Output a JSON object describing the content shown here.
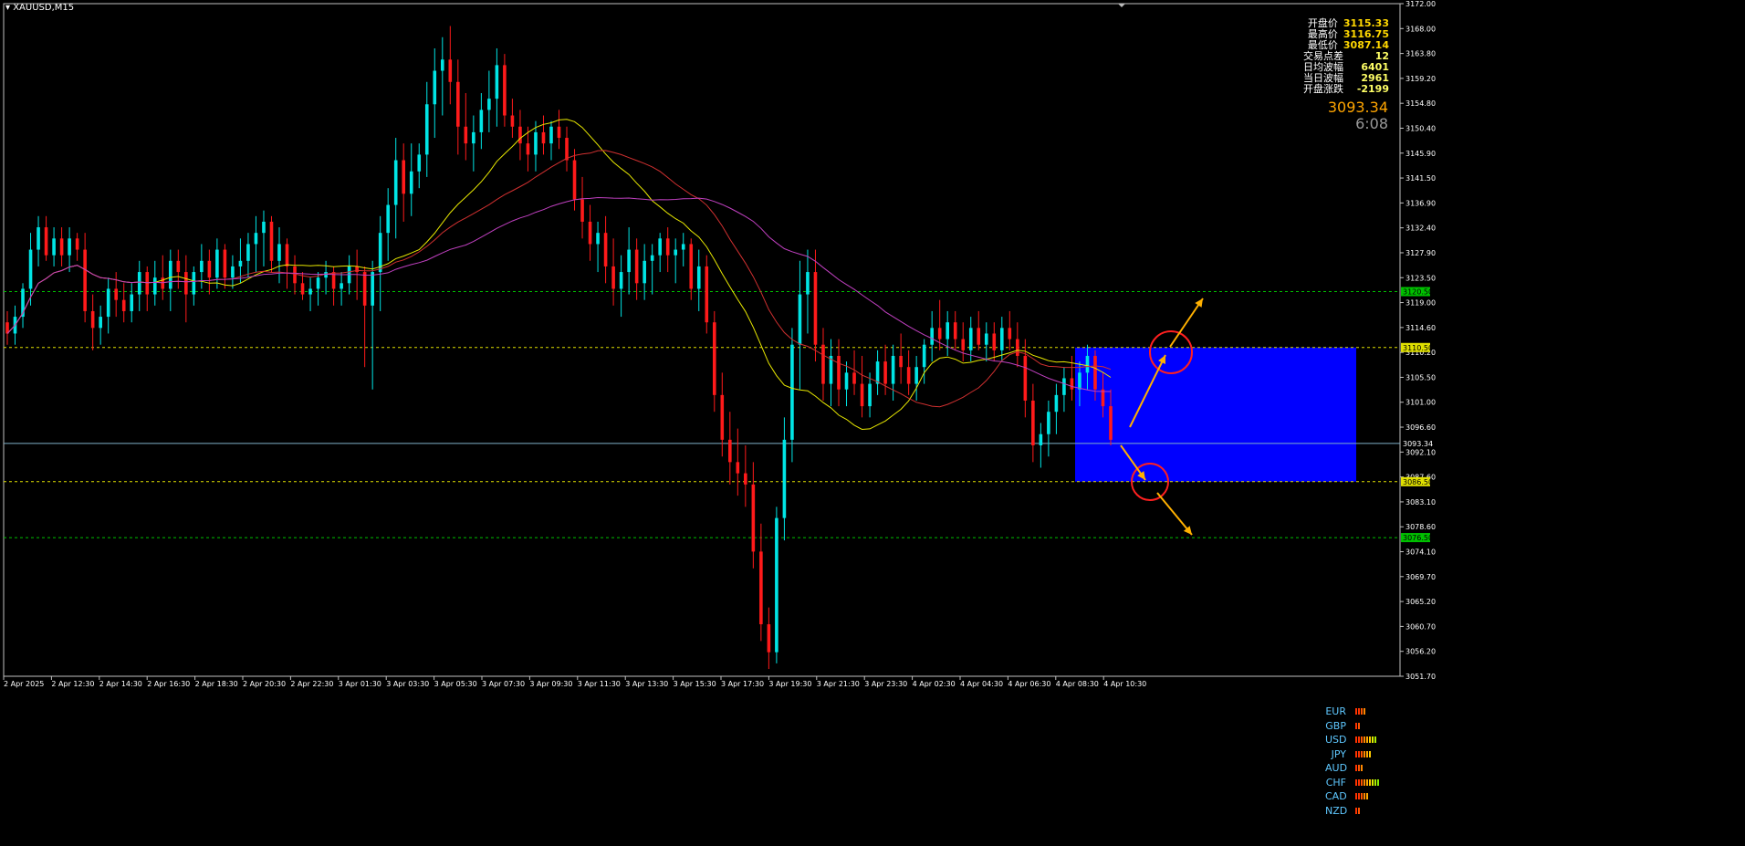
{
  "symbol": "XAUUSD,M15",
  "info": {
    "rows": [
      {
        "label": "开盘价",
        "value": "3115.33"
      },
      {
        "label": "最高价",
        "value": "3116.75"
      },
      {
        "label": "最低价",
        "value": "3087.14"
      },
      {
        "label": "交易点差",
        "value": "12"
      },
      {
        "label": "日均波幅",
        "value": "6401"
      },
      {
        "label": "当日波幅",
        "value": "2961"
      },
      {
        "label": "开盘涨跌",
        "value": "-2199"
      }
    ],
    "current_price": "3093.34",
    "countdown": "6:08"
  },
  "chart_data": {
    "type": "candlestick",
    "ylim": [
      3051.7,
      3172.0
    ],
    "y_ticks": [
      "3172.00",
      "3168.00",
      "3163.80",
      "3159.20",
      "3154.80",
      "3150.40",
      "3145.90",
      "3141.50",
      "3136.90",
      "3132.40",
      "3127.90",
      "3123.50",
      "3119.00",
      "3114.60",
      "3110.20",
      "3105.50",
      "3101.00",
      "3096.60",
      "3092.10",
      "3087.60",
      "3083.10",
      "3078.60",
      "3074.10",
      "3069.70",
      "3065.20",
      "3060.70",
      "3056.20",
      "3051.70"
    ],
    "x_ticks": [
      "2 Apr 2025",
      "2 Apr 12:30",
      "2 Apr 14:30",
      "2 Apr 16:30",
      "2 Apr 18:30",
      "2 Apr 20:30",
      "2 Apr 22:30",
      "3 Apr 01:30",
      "3 Apr 03:30",
      "3 Apr 05:30",
      "3 Apr 07:30",
      "3 Apr 09:30",
      "3 Apr 11:30",
      "3 Apr 13:30",
      "3 Apr 15:30",
      "3 Apr 17:30",
      "3 Apr 19:30",
      "3 Apr 21:30",
      "3 Apr 23:30",
      "4 Apr 02:30",
      "4 Apr 04:30",
      "4 Apr 06:30",
      "4 Apr 08:30",
      "4 Apr 10:30"
    ],
    "horizontal_levels": [
      {
        "value": 3120.5,
        "label": "3120.50",
        "color": "#00c000"
      },
      {
        "value": 3110.5,
        "label": "3110.50",
        "color": "#e0e000"
      },
      {
        "value": 3093.34,
        "label": "3093.34",
        "color": "#7fb0c8"
      },
      {
        "value": 3086.5,
        "label": "3086.50",
        "color": "#e0e000"
      },
      {
        "value": 3076.5,
        "label": "3076.50",
        "color": "#00c000"
      }
    ],
    "candles": [
      [
        3115,
        3117,
        3111,
        3113
      ],
      [
        3113,
        3118,
        3111,
        3116
      ],
      [
        3116,
        3122,
        3114,
        3121
      ],
      [
        3121,
        3131,
        3118,
        3128
      ],
      [
        3128,
        3134,
        3125,
        3132
      ],
      [
        3132,
        3134,
        3126,
        3127
      ],
      [
        3127,
        3132,
        3125,
        3130
      ],
      [
        3130,
        3132,
        3125,
        3127
      ],
      [
        3127,
        3132,
        3124,
        3130
      ],
      [
        3130,
        3131,
        3126,
        3128
      ],
      [
        3128,
        3131,
        3115,
        3117
      ],
      [
        3117,
        3120,
        3110,
        3114
      ],
      [
        3114,
        3118,
        3111,
        3116
      ],
      [
        3116,
        3123,
        3113,
        3121
      ],
      [
        3121,
        3124,
        3116,
        3119
      ],
      [
        3119,
        3122,
        3115,
        3117
      ],
      [
        3117,
        3122,
        3115,
        3120
      ],
      [
        3120,
        3126,
        3117,
        3124
      ],
      [
        3124,
        3125,
        3117,
        3120
      ],
      [
        3120,
        3126,
        3118,
        3123
      ],
      [
        3123,
        3127,
        3119,
        3121
      ],
      [
        3121,
        3128,
        3117,
        3126
      ],
      [
        3126,
        3128,
        3121,
        3124
      ],
      [
        3124,
        3127,
        3115,
        3120
      ],
      [
        3120,
        3125,
        3118,
        3124
      ],
      [
        3124,
        3129,
        3121,
        3126
      ],
      [
        3126,
        3128,
        3120,
        3123
      ],
      [
        3123,
        3130,
        3121,
        3128
      ],
      [
        3128,
        3129,
        3121,
        3123
      ],
      [
        3123,
        3127,
        3121,
        3125
      ],
      [
        3125,
        3130,
        3122,
        3126
      ],
      [
        3126,
        3131,
        3123,
        3129
      ],
      [
        3129,
        3134,
        3124,
        3131
      ],
      [
        3131,
        3135,
        3125,
        3133
      ],
      [
        3133,
        3134,
        3124,
        3126
      ],
      [
        3126,
        3132,
        3122,
        3129
      ],
      [
        3129,
        3130,
        3121,
        3125
      ],
      [
        3125,
        3127,
        3120,
        3122
      ],
      [
        3122,
        3124,
        3119,
        3120
      ],
      [
        3120,
        3123,
        3117,
        3121
      ],
      [
        3121,
        3124,
        3118,
        3123
      ],
      [
        3123,
        3126,
        3120,
        3124
      ],
      [
        3124,
        3125,
        3118,
        3121
      ],
      [
        3121,
        3124,
        3118,
        3122
      ],
      [
        3122,
        3127,
        3120,
        3125
      ],
      [
        3125,
        3128,
        3119,
        3124
      ],
      [
        3124,
        3125,
        3107,
        3118
      ],
      [
        3118,
        3126,
        3103,
        3124
      ],
      [
        3124,
        3134,
        3117,
        3131
      ],
      [
        3131,
        3139,
        3126,
        3136
      ],
      [
        3136,
        3148,
        3130,
        3144
      ],
      [
        3144,
        3147,
        3133,
        3138
      ],
      [
        3138,
        3147,
        3134,
        3142
      ],
      [
        3142,
        3147,
        3139,
        3145
      ],
      [
        3145,
        3158,
        3141,
        3154
      ],
      [
        3154,
        3164,
        3148,
        3160
      ],
      [
        3160,
        3166,
        3152,
        3162
      ],
      [
        3162,
        3168,
        3154,
        3158
      ],
      [
        3158,
        3162,
        3145,
        3150
      ],
      [
        3150,
        3156,
        3144,
        3147
      ],
      [
        3147,
        3152,
        3142,
        3149
      ],
      [
        3149,
        3156,
        3146,
        3153
      ],
      [
        3153,
        3160,
        3149,
        3155
      ],
      [
        3155,
        3164,
        3150,
        3161
      ],
      [
        3161,
        3163,
        3150,
        3152
      ],
      [
        3152,
        3155,
        3148,
        3150
      ],
      [
        3150,
        3153,
        3144,
        3147
      ],
      [
        3147,
        3150,
        3142,
        3145
      ],
      [
        3145,
        3151,
        3142,
        3149
      ],
      [
        3149,
        3152,
        3145,
        3147
      ],
      [
        3147,
        3151,
        3144,
        3150
      ],
      [
        3150,
        3153,
        3146,
        3148
      ],
      [
        3148,
        3150,
        3142,
        3144
      ],
      [
        3144,
        3146,
        3135,
        3137
      ],
      [
        3137,
        3141,
        3130,
        3133
      ],
      [
        3133,
        3136,
        3126,
        3129
      ],
      [
        3129,
        3133,
        3124,
        3131
      ],
      [
        3131,
        3134,
        3122,
        3125
      ],
      [
        3125,
        3130,
        3118,
        3121
      ],
      [
        3121,
        3127,
        3116,
        3124
      ],
      [
        3124,
        3132,
        3120,
        3128
      ],
      [
        3128,
        3130,
        3119,
        3122
      ],
      [
        3122,
        3129,
        3119,
        3126
      ],
      [
        3126,
        3129,
        3120,
        3127
      ],
      [
        3127,
        3131,
        3124,
        3130
      ],
      [
        3130,
        3132,
        3124,
        3127
      ],
      [
        3127,
        3130,
        3122,
        3128
      ],
      [
        3128,
        3131,
        3125,
        3129
      ],
      [
        3129,
        3130,
        3119,
        3121
      ],
      [
        3121,
        3128,
        3117,
        3125
      ],
      [
        3125,
        3127,
        3113,
        3115
      ],
      [
        3115,
        3117,
        3099,
        3102
      ],
      [
        3102,
        3106,
        3091,
        3094
      ],
      [
        3094,
        3099,
        3086,
        3090
      ],
      [
        3090,
        3096,
        3084,
        3088
      ],
      [
        3088,
        3093,
        3082,
        3086
      ],
      [
        3086,
        3090,
        3071,
        3074
      ],
      [
        3074,
        3079,
        3058,
        3061
      ],
      [
        3061,
        3064,
        3053,
        3056
      ],
      [
        3056,
        3082,
        3054,
        3080
      ],
      [
        3080,
        3098,
        3076,
        3094
      ],
      [
        3094,
        3114,
        3090,
        3111
      ],
      [
        3111,
        3126,
        3103,
        3120
      ],
      [
        3120,
        3128,
        3113,
        3124
      ],
      [
        3124,
        3128,
        3108,
        3111
      ],
      [
        3111,
        3114,
        3101,
        3104
      ],
      [
        3104,
        3112,
        3100,
        3109
      ],
      [
        3109,
        3112,
        3100,
        3103
      ],
      [
        3103,
        3108,
        3100,
        3106
      ],
      [
        3106,
        3110,
        3102,
        3104
      ],
      [
        3104,
        3109,
        3098,
        3100
      ],
      [
        3100,
        3106,
        3098,
        3104
      ],
      [
        3104,
        3110,
        3102,
        3108
      ],
      [
        3108,
        3111,
        3102,
        3104
      ],
      [
        3104,
        3111,
        3101,
        3109
      ],
      [
        3109,
        3113,
        3104,
        3107
      ],
      [
        3107,
        3110,
        3102,
        3104
      ],
      [
        3104,
        3109,
        3101,
        3107
      ],
      [
        3107,
        3112,
        3104,
        3111
      ],
      [
        3111,
        3117,
        3108,
        3114
      ],
      [
        3114,
        3119,
        3110,
        3112
      ],
      [
        3112,
        3117,
        3109,
        3115
      ],
      [
        3115,
        3117,
        3110,
        3112
      ],
      [
        3112,
        3115,
        3108,
        3110
      ],
      [
        3110,
        3116,
        3108,
        3114
      ],
      [
        3114,
        3117,
        3110,
        3111
      ],
      [
        3111,
        3115,
        3108,
        3113
      ],
      [
        3113,
        3115,
        3108,
        3110
      ],
      [
        3110,
        3116,
        3108,
        3114
      ],
      [
        3114,
        3117,
        3110,
        3112
      ],
      [
        3112,
        3115,
        3107,
        3109
      ],
      [
        3109,
        3112,
        3098,
        3101
      ],
      [
        3101,
        3104,
        3090,
        3093
      ],
      [
        3093,
        3097,
        3089,
        3095
      ],
      [
        3095,
        3101,
        3091,
        3099
      ],
      [
        3099,
        3104,
        3095,
        3102
      ],
      [
        3102,
        3107,
        3099,
        3105
      ],
      [
        3105,
        3109,
        3101,
        3103
      ],
      [
        3103,
        3108,
        3100,
        3106
      ],
      [
        3106,
        3111,
        3103,
        3109
      ],
      [
        3109,
        3110,
        3101,
        3103
      ],
      [
        3103,
        3106,
        3098,
        3100
      ],
      [
        3100,
        3103,
        3093,
        3094
      ]
    ],
    "moving_averages": [
      {
        "color": "#e8e800"
      },
      {
        "color": "#d03030"
      },
      {
        "color": "#c040c0"
      }
    ],
    "zone": {
      "top": 3110.5,
      "bottom": 3086.5,
      "color": "#0000ff"
    }
  },
  "currency_strength": [
    {
      "name": "EUR",
      "bars": [
        "#ff3300",
        "#ff3300",
        "#ff5500",
        "#ff8800"
      ]
    },
    {
      "name": "GBP",
      "bars": [
        "#ff3300",
        "#ff5500"
      ]
    },
    {
      "name": "USD",
      "bars": [
        "#ff3300",
        "#ff3300",
        "#ff5500",
        "#ff8800",
        "#ffaa00",
        "#ffcc00",
        "#ddee00",
        "#aaee00"
      ]
    },
    {
      "name": "JPY",
      "bars": [
        "#ff3300",
        "#ff3300",
        "#ff5500",
        "#ff8800",
        "#ffaa00",
        "#ffcc00"
      ]
    },
    {
      "name": "AUD",
      "bars": [
        "#ff3300",
        "#ff5500",
        "#ff8800"
      ]
    },
    {
      "name": "CHF",
      "bars": [
        "#ff3300",
        "#ff3300",
        "#ff5500",
        "#ff8800",
        "#ffaa00",
        "#ffcc00",
        "#ddee00",
        "#aaee00",
        "#88ee00"
      ]
    },
    {
      "name": "CAD",
      "bars": [
        "#ff3300",
        "#ff3300",
        "#ff5500",
        "#ff8800",
        "#ffaa00"
      ]
    },
    {
      "name": "NZD",
      "bars": [
        "#ff3300",
        "#ff5500"
      ]
    }
  ]
}
